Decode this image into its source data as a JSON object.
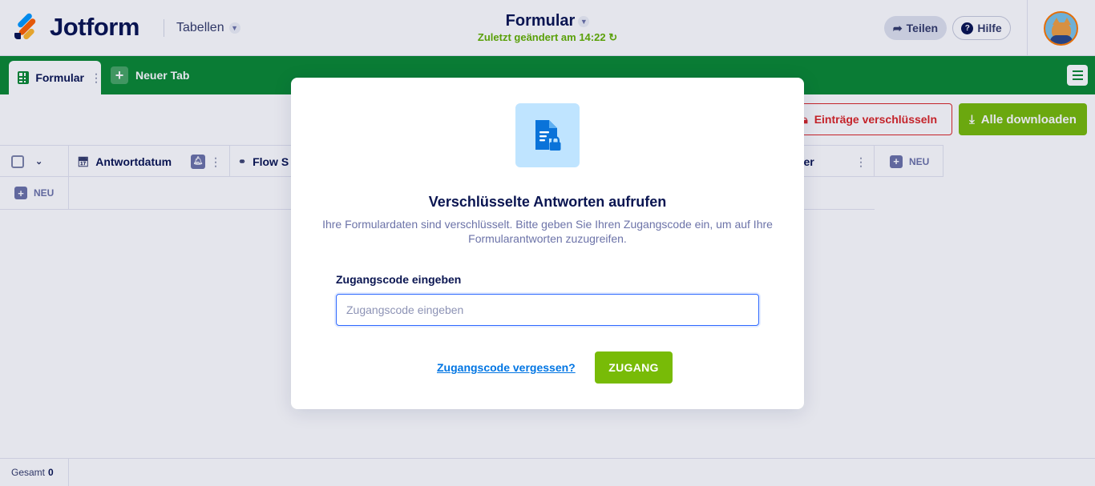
{
  "header": {
    "brand": "Jotform",
    "tables_label": "Tabellen",
    "form_title": "Formular",
    "last_changed": "Zuletzt geändert am 14:22",
    "share_label": "Teilen",
    "help_label": "Hilfe"
  },
  "tabs": {
    "active_label": "Formular",
    "new_tab_label": "Neuer Tab"
  },
  "toolbar": {
    "encrypt_label": "Einträge verschlüsseln",
    "download_label": "Alle downloaden"
  },
  "table": {
    "columns": [
      {
        "label": "Antwortdatum",
        "icon": "calendar-icon"
      },
      {
        "label": "Flow S",
        "icon": "flow-icon"
      },
      {
        "label": "mer",
        "icon": ""
      }
    ],
    "new_column_label": "NEU",
    "new_row_label": "NEU"
  },
  "footer": {
    "total_label": "Gesamt",
    "total_value": "0"
  },
  "modal": {
    "title": "Verschlüsselte Antworten aufrufen",
    "description": "Ihre Formulardaten sind verschlüsselt. Bitte geben Sie Ihren Zugangscode ein, um auf Ihre Formularantworten zuzugreifen.",
    "field_label": "Zugangscode eingeben",
    "input_placeholder": "Zugangscode eingeben",
    "input_value": "",
    "forgot_label": "Zugangscode vergessen?",
    "submit_label": "ZUGANG"
  },
  "colors": {
    "brand_green": "#0b8a32",
    "action_green": "#78bb07",
    "danger_red": "#dc2626",
    "link_blue": "#0075e3",
    "navy": "#0a1551"
  }
}
